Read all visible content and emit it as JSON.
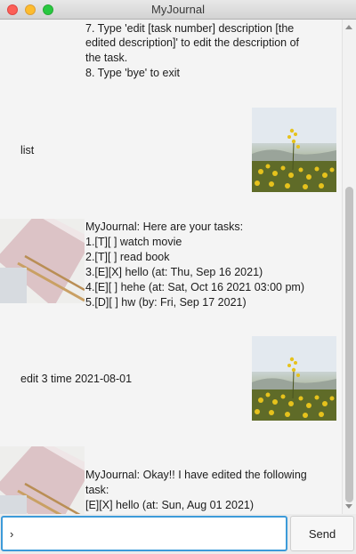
{
  "window": {
    "title": "MyJournal"
  },
  "messages": {
    "help_tail": {
      "line1": "7. Type 'edit [task number] description [the",
      "line2": "edited description]' to edit the description  of",
      "line3": "the task.",
      "line4": "8. Type 'bye' to exit"
    },
    "user_list": {
      "text": "list"
    },
    "tasks_reply": {
      "header": "MyJournal: Here are your tasks:",
      "items": [
        "1.[T][ ] watch movie",
        "2.[T][ ] read book",
        "3.[E][X] hello (at: Thu, Sep 16 2021)",
        "4.[E][ ] hehe (at: Sat, Oct 16 2021 03:00 pm)",
        "5.[D][ ] hw (by: Fri, Sep 17 2021)"
      ]
    },
    "user_edit": {
      "text": "edit 3 time 2021-08-01"
    },
    "edit_reply": {
      "line1": "MyJournal: Okay!! I have edited the following",
      "line2": "task:",
      "line3": "[E][X] hello (at: Sun, Aug 01 2021)"
    }
  },
  "input": {
    "value": "›",
    "placeholder": ""
  },
  "send": {
    "label": "Send"
  },
  "colors": {
    "accent": "#3d9bd9",
    "background": "#f4f4f4"
  },
  "icons": {
    "user_avatar": "flowers-photo",
    "bot_avatar": "notebook-photo"
  }
}
